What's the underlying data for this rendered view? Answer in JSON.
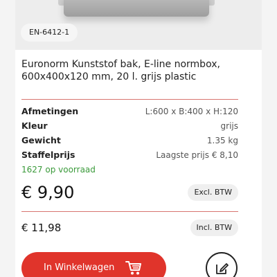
{
  "product": {
    "sku": "EN-6412-1",
    "title_line1": "Euronorm Kunststof bak, E-line normbox,",
    "title_line2": "600x400x120 mm, 20 l. grijs plastic"
  },
  "specs": [
    {
      "label": "Afmetingen",
      "value": "L:600 x B:400 x H:120"
    },
    {
      "label": "Kleur",
      "value": "grijs"
    },
    {
      "label": "Gewicht",
      "value": "1.35 kg"
    },
    {
      "label": "Staffelprijs",
      "value": "Laagste prijs € 8,10"
    }
  ],
  "stock": "1627 op voorraad",
  "pricing": {
    "excl_price": "€ 9,90",
    "excl_label": "Excl. BTW",
    "incl_price": "€ 11,98",
    "incl_label": "Incl. BTW"
  },
  "actions": {
    "cart_label": "In Winkelwagen",
    "cart_icon": "shopping-cart-icon",
    "edit_icon": "edit-pencil-icon"
  },
  "colors": {
    "accent": "#e0342b",
    "divider": "#d8746f",
    "stock": "#3a9a3a"
  }
}
